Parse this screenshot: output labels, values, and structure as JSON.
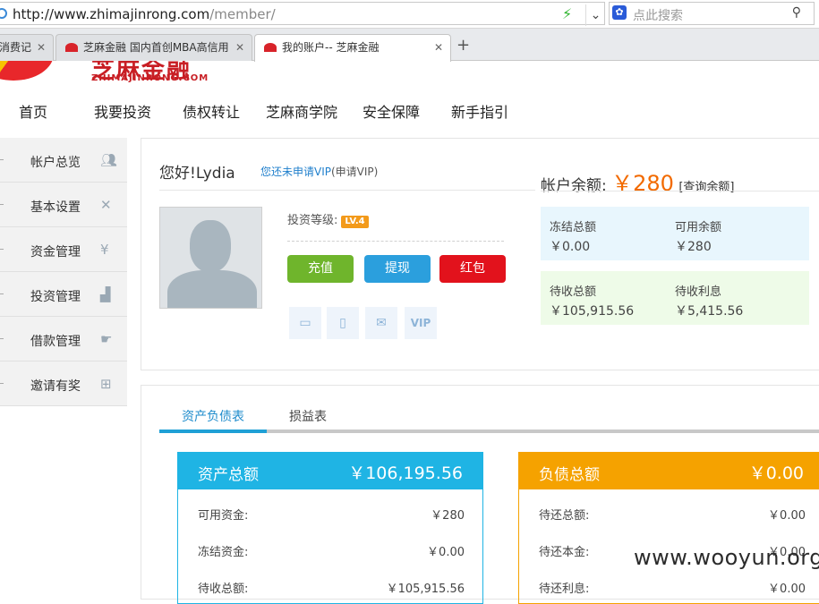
{
  "browser": {
    "url_host": "http://www.zhimajinrong.com",
    "url_path": "/member/",
    "search_placeholder": "点此搜索",
    "tabs": [
      {
        "label": "消费记",
        "active": false
      },
      {
        "label": "芝麻金融 国内首创MBA高信用",
        "active": false
      },
      {
        "label": "我的账户-- 芝麻金融",
        "active": true
      }
    ],
    "new_tab_glyph": "+"
  },
  "site": {
    "logo_cn": "芝麻金融",
    "logo_en": "ZHIMAJINRONG.COM",
    "nav": [
      "首页",
      "我要投资",
      "债权转让",
      "芝麻商学院",
      "安全保障",
      "新手指引"
    ]
  },
  "sidebar": {
    "items": [
      {
        "label": "帐户总览",
        "icon": "user-icon"
      },
      {
        "label": "基本设置",
        "icon": "tools-icon"
      },
      {
        "label": "资金管理",
        "icon": "yen-icon"
      },
      {
        "label": "投资管理",
        "icon": "chart-icon"
      },
      {
        "label": "借款管理",
        "icon": "hand-icon"
      },
      {
        "label": "邀请有奖",
        "icon": "gift-icon"
      }
    ]
  },
  "account": {
    "greeting": "您好!Lydia",
    "vip_apply_text": "您还未申请VIP",
    "vip_apply_link": "(申请VIP)",
    "balance_label": "帐户余额:",
    "balance_value": "￥280",
    "balance_query": "[查询余额]",
    "invest_level_label": "投资等级:",
    "invest_level_badge": "LV.4",
    "buttons": {
      "recharge": "充值",
      "withdraw": "提现",
      "redpack": "红包"
    },
    "verify_icons": [
      "bank-card-icon",
      "phone-icon",
      "email-icon",
      "vip-icon"
    ],
    "frozen_total_label": "冻结总额",
    "frozen_total_value": "￥0.00",
    "available_label": "可用余额",
    "available_value": "￥280",
    "pending_total_label": "待收总额",
    "pending_total_value": "￥105,915.56",
    "pending_interest_label": "待收利息",
    "pending_interest_value": "￥5,415.56"
  },
  "sheet": {
    "tabs": [
      "资产负债表",
      "损益表"
    ],
    "assets": {
      "title": "资产总额",
      "total": "￥106,195.56",
      "rows": [
        {
          "label": "可用资金:",
          "value": "￥280"
        },
        {
          "label": "冻结资金:",
          "value": "￥0.00"
        },
        {
          "label": "待收总额:",
          "value": "￥105,915.56"
        }
      ]
    },
    "liabilities": {
      "title": "负债总额",
      "total": "￥0.00",
      "rows": [
        {
          "label": "待还总额:",
          "value": "￥0.00"
        },
        {
          "label": "待还本金:",
          "value": "￥0.00"
        },
        {
          "label": "待还利息:",
          "value": "￥0.00"
        }
      ]
    }
  },
  "watermark": "www.wooyun.org",
  "colors": {
    "orange": "#f26a00",
    "blue": "#1fb4e4",
    "amber": "#f5a200",
    "green": "#6fb52c",
    "red": "#e2121c"
  }
}
